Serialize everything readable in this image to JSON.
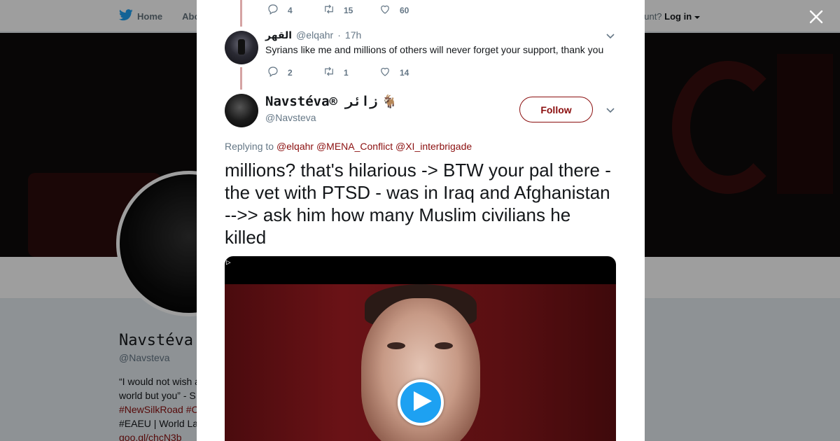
{
  "nav": {
    "home_label": "Home",
    "about_label": "Abo",
    "account_prompt": "ccount?",
    "login_label": "Log in"
  },
  "profile": {
    "name": "Navstéva",
    "handle": "@Navsteva",
    "bio_lines": [
      "“I would not wish a",
      "world but you” - S",
      "#NewSilkRoad #C",
      "#EAEU | World La",
      "goo.gl/chcN3b"
    ]
  },
  "thread": {
    "top_actions": {
      "replies": "4",
      "retweets": "15",
      "likes": "60"
    },
    "reply": {
      "name": "القهر",
      "handle": "@elqahr",
      "separator": "·",
      "time": "17h",
      "text": "Syrians like me and millions of others will never forget your support, thank you",
      "actions": {
        "replies": "2",
        "retweets": "1",
        "likes": "14"
      }
    }
  },
  "tweet": {
    "name": "Navstéva® زائر",
    "emoji": "🐐",
    "handle": "@Navsteva",
    "follow_label": "Follow",
    "replying_prefix": "Replying to",
    "replying_to": [
      "@elqahr",
      "@MENA_Conflict",
      "@XI_interbrigade"
    ],
    "text": "millions? that's hilarious -> BTW your pal there - the vet with PTSD - was in Iraq and Afghanistan -->> ask him how many Muslim civilians he killed",
    "media_glyph": "▷"
  },
  "colors": {
    "accent": "#8b0f0f",
    "play": "#1da1f2",
    "thread_line": "#d5a3a3"
  },
  "icons": [
    "twitter-bird-icon",
    "caret-down-icon",
    "close-icon",
    "reply-icon",
    "retweet-icon",
    "heart-icon",
    "chevron-down-icon",
    "play-icon"
  ]
}
